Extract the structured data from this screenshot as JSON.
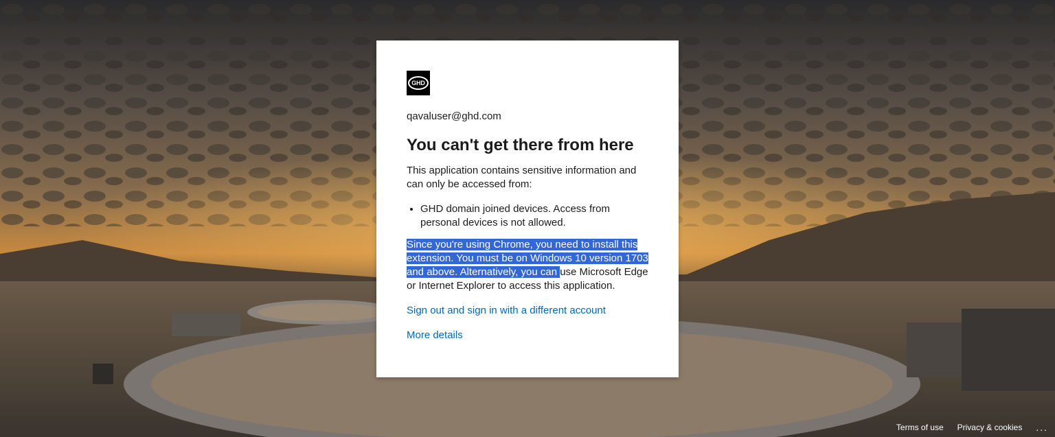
{
  "account": {
    "email": "qavaluser@ghd.com"
  },
  "logo": {
    "text": "GHD",
    "icon": "ghd-logo-icon"
  },
  "error": {
    "title": "You can't get there from here",
    "description": "This application contains sensitive information and can only be accessed from:",
    "requirements": [
      "GHD domain joined devices. Access from personal devices is not allowed."
    ],
    "browser_message_selected": "Since you're using Chrome, you need to install this extension. You must be on Windows 10 version 1703 and above. Alternatively, you can ",
    "browser_message_rest": "use Microsoft Edge or Internet Explorer to access this application."
  },
  "links": {
    "sign_out": "Sign out and sign in with a different account",
    "more_details": "More details"
  },
  "footer": {
    "terms": "Terms of use",
    "privacy": "Privacy & cookies",
    "more": "..."
  },
  "colors": {
    "link": "#0067b8",
    "selection": "#3367d6",
    "text": "#1b1b1b"
  }
}
